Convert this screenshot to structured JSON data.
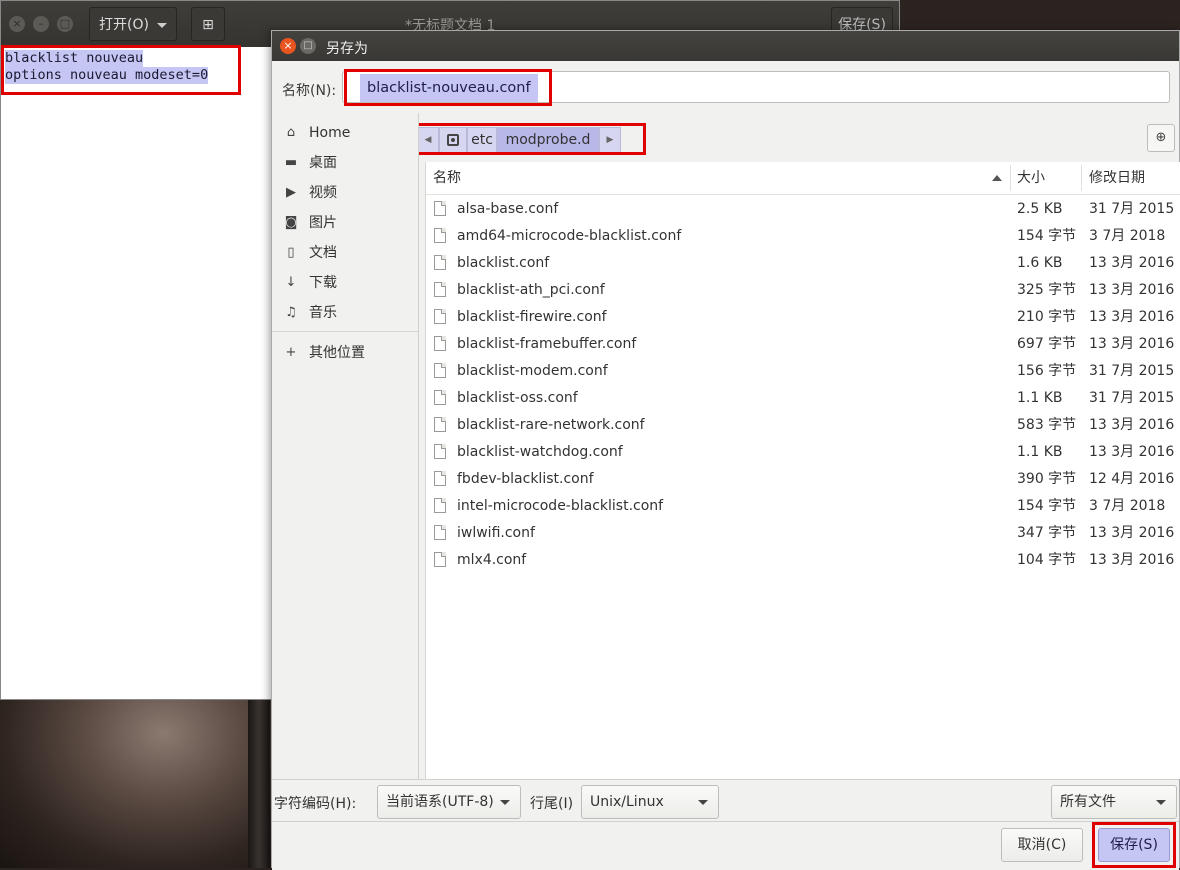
{
  "editor": {
    "open_label": "打开(O)",
    "new_tab_icon": "new-document-icon",
    "title": "*无标题文档 1",
    "save_label": "保存(S)",
    "lines": [
      "blacklist nouveau",
      "options nouveau modeset=0"
    ]
  },
  "dialog": {
    "title": "另存为",
    "name_label": "名称(N):",
    "name_value": "blacklist-nouveau.conf",
    "breadcrumb": {
      "parent": "etc",
      "current": "modprobe.d"
    },
    "sidebar": [
      {
        "icon": "home-icon",
        "label": "Home"
      },
      {
        "icon": "desktop-folder-icon",
        "label": "桌面"
      },
      {
        "icon": "video-icon",
        "label": "视频"
      },
      {
        "icon": "camera-icon",
        "label": "图片"
      },
      {
        "icon": "document-icon",
        "label": "文档"
      },
      {
        "icon": "download-icon",
        "label": "下载"
      },
      {
        "icon": "music-icon",
        "label": "音乐"
      },
      {
        "icon": "plus-icon",
        "label": "其他位置"
      }
    ],
    "columns": {
      "name": "名称",
      "size": "大小",
      "modified": "修改日期"
    },
    "files": [
      {
        "name": "alsa-base.conf",
        "size": "2.5 KB",
        "modified": "31 7月 2015"
      },
      {
        "name": "amd64-microcode-blacklist.conf",
        "size": "154 字节",
        "modified": "3 7月 2018"
      },
      {
        "name": "blacklist.conf",
        "size": "1.6 KB",
        "modified": "13 3月 2016"
      },
      {
        "name": "blacklist-ath_pci.conf",
        "size": "325 字节",
        "modified": "13 3月 2016"
      },
      {
        "name": "blacklist-firewire.conf",
        "size": "210 字节",
        "modified": "13 3月 2016"
      },
      {
        "name": "blacklist-framebuffer.conf",
        "size": "697 字节",
        "modified": "13 3月 2016"
      },
      {
        "name": "blacklist-modem.conf",
        "size": "156 字节",
        "modified": "31 7月 2015"
      },
      {
        "name": "blacklist-oss.conf",
        "size": "1.1 KB",
        "modified": "31 7月 2015"
      },
      {
        "name": "blacklist-rare-network.conf",
        "size": "583 字节",
        "modified": "13 3月 2016"
      },
      {
        "name": "blacklist-watchdog.conf",
        "size": "1.1 KB",
        "modified": "13 3月 2016"
      },
      {
        "name": "fbdev-blacklist.conf",
        "size": "390 字节",
        "modified": "12 4月 2016"
      },
      {
        "name": "intel-microcode-blacklist.conf",
        "size": "154 字节",
        "modified": "3 7月 2018"
      },
      {
        "name": "iwlwifi.conf",
        "size": "347 字节",
        "modified": "13 3月 2016"
      },
      {
        "name": "mlx4.conf",
        "size": "104 字节",
        "modified": "13 3月 2016"
      }
    ],
    "encoding_label": "字符编码(H):",
    "encoding_value": "当前语系(UTF-8)",
    "line_ending_label": "行尾(I)",
    "line_ending_value": "Unix/Linux",
    "filter_value": "所有文件",
    "cancel_label": "取消(C)",
    "save_label": "保存(S)"
  }
}
